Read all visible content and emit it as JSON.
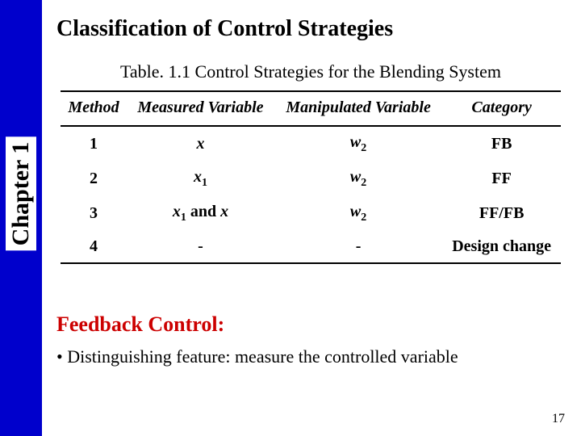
{
  "chapter_label": "Chapter 1",
  "title": "Classification of Control Strategies",
  "table_caption": "Table. 1.1 Control Strategies for the Blending System",
  "headers": {
    "c1": "Method",
    "c2": "Measured Variable",
    "c3": "Manipulated Variable",
    "c4": "Category"
  },
  "rows": [
    {
      "method": "1",
      "measured_html": "<span class='ital'>x</span>",
      "manip_html": "<span class='ital'>w</span><sub>2</sub>",
      "category": "FB"
    },
    {
      "method": "2",
      "measured_html": "<span class='ital'>x</span><sub>1</sub>",
      "manip_html": "<span class='ital'>w</span><sub>2</sub>",
      "category": "FF"
    },
    {
      "method": "3",
      "measured_html": "<span class='ital'>x</span><sub>1</sub> and <span class='ital'>x</span>",
      "manip_html": "<span class='ital'>w</span><sub>2</sub>",
      "category": "FF/FB"
    },
    {
      "method": "4",
      "measured_html": "-",
      "manip_html": "-",
      "category": "Design change"
    }
  ],
  "section_heading": "Feedback Control:",
  "bullet1": "• Distinguishing feature: measure the controlled variable",
  "page_number": "17",
  "chart_data": {
    "type": "table",
    "title": "Table. 1.1 Control Strategies for the Blending System",
    "columns": [
      "Method",
      "Measured Variable",
      "Manipulated Variable",
      "Category"
    ],
    "rows": [
      [
        "1",
        "x",
        "w2",
        "FB"
      ],
      [
        "2",
        "x1",
        "w2",
        "FF"
      ],
      [
        "3",
        "x1 and x",
        "w2",
        "FF/FB"
      ],
      [
        "4",
        "-",
        "-",
        "Design change"
      ]
    ]
  }
}
